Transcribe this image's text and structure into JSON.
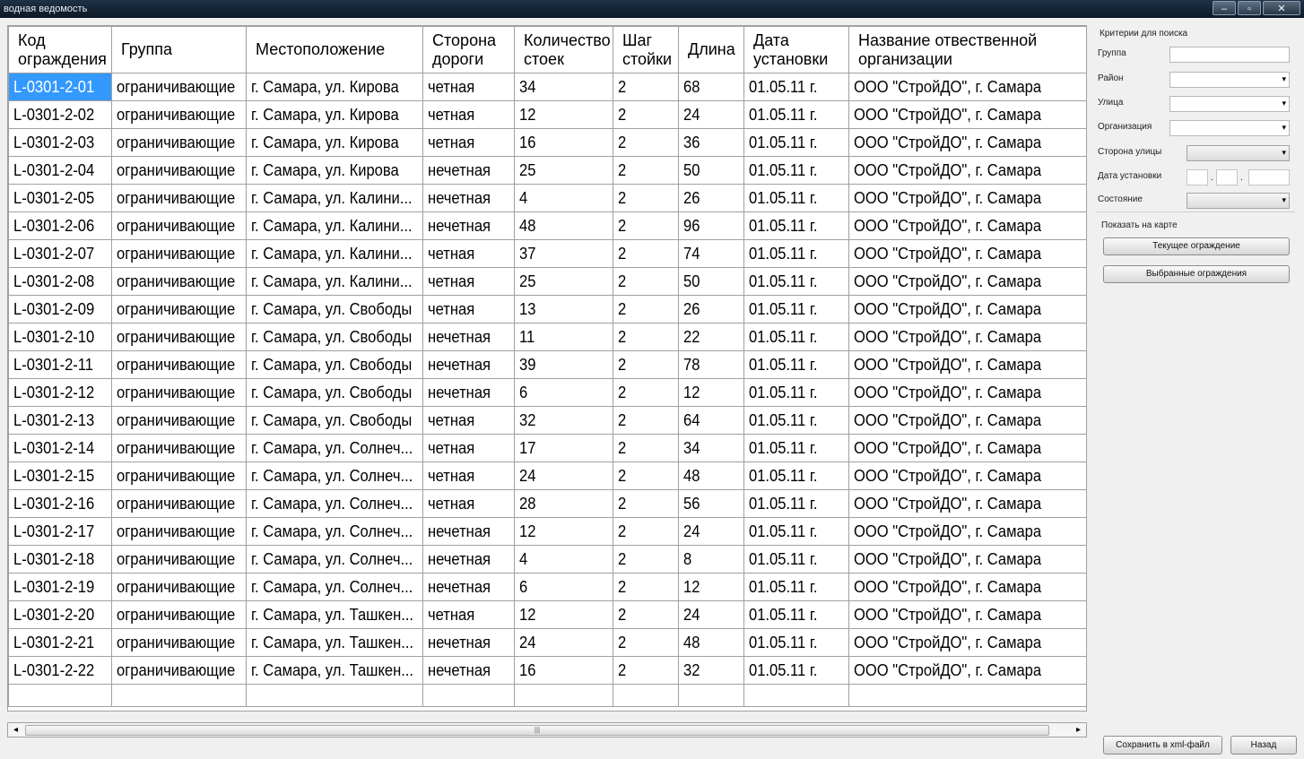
{
  "window": {
    "title": "водная ведомость",
    "minimize": "–",
    "maximize": "▫",
    "close": "✕"
  },
  "table": {
    "columns": [
      "Код ограждения",
      "Группа",
      "Местоположение",
      "Сторона дороги",
      "Количество стоек",
      "Шаг стойки",
      "Длина",
      "Дата установки",
      "Название отвественной организации"
    ],
    "rows": [
      [
        "L-0301-2-01",
        "ограничивающие",
        "г. Самара, ул. Кирова",
        "четная",
        "34",
        "2",
        "68",
        "01.05.11 г.",
        "ООО \"СтройДО\", г. Самара"
      ],
      [
        "L-0301-2-02",
        "ограничивающие",
        "г. Самара, ул. Кирова",
        "четная",
        "12",
        "2",
        "24",
        "01.05.11 г.",
        "ООО \"СтройДО\", г. Самара"
      ],
      [
        "L-0301-2-03",
        "ограничивающие",
        "г. Самара, ул. Кирова",
        "четная",
        "16",
        "2",
        "36",
        "01.05.11 г.",
        "ООО \"СтройДО\", г. Самара"
      ],
      [
        "L-0301-2-04",
        "ограничивающие",
        "г. Самара, ул. Кирова",
        "нечетная",
        "25",
        "2",
        "50",
        "01.05.11 г.",
        "ООО \"СтройДО\", г. Самара"
      ],
      [
        "L-0301-2-05",
        "ограничивающие",
        "г. Самара, ул. Калини...",
        "нечетная",
        "4",
        "2",
        "26",
        "01.05.11 г.",
        "ООО \"СтройДО\", г. Самара"
      ],
      [
        "L-0301-2-06",
        "ограничивающие",
        "г. Самара, ул. Калини...",
        "нечетная",
        "48",
        "2",
        "96",
        "01.05.11 г.",
        "ООО \"СтройДО\", г. Самара"
      ],
      [
        "L-0301-2-07",
        "ограничивающие",
        "г. Самара, ул. Калини...",
        "четная",
        "37",
        "2",
        "74",
        "01.05.11 г.",
        "ООО \"СтройДО\", г. Самара"
      ],
      [
        "L-0301-2-08",
        "ограничивающие",
        "г. Самара, ул. Калини...",
        "четная",
        "25",
        "2",
        "50",
        "01.05.11 г.",
        "ООО \"СтройДО\", г. Самара"
      ],
      [
        "L-0301-2-09",
        "ограничивающие",
        "г. Самара, ул. Свободы",
        "четная",
        "13",
        "2",
        "26",
        "01.05.11 г.",
        "ООО \"СтройДО\", г. Самара"
      ],
      [
        "L-0301-2-10",
        "ограничивающие",
        "г. Самара, ул. Свободы",
        "нечетная",
        "11",
        "2",
        "22",
        "01.05.11 г.",
        "ООО \"СтройДО\", г. Самара"
      ],
      [
        "L-0301-2-11",
        "ограничивающие",
        "г. Самара, ул. Свободы",
        "нечетная",
        "39",
        "2",
        "78",
        "01.05.11 г.",
        "ООО \"СтройДО\", г. Самара"
      ],
      [
        "L-0301-2-12",
        "ограничивающие",
        "г. Самара, ул. Свободы",
        "нечетная",
        "6",
        "2",
        "12",
        "01.05.11 г.",
        "ООО \"СтройДО\", г. Самара"
      ],
      [
        "L-0301-2-13",
        "ограничивающие",
        "г. Самара, ул. Свободы",
        "четная",
        "32",
        "2",
        "64",
        "01.05.11 г.",
        "ООО \"СтройДО\", г. Самара"
      ],
      [
        "L-0301-2-14",
        "ограничивающие",
        "г. Самара, ул. Солнеч...",
        "четная",
        "17",
        "2",
        "34",
        "01.05.11 г.",
        "ООО \"СтройДО\", г. Самара"
      ],
      [
        "L-0301-2-15",
        "ограничивающие",
        "г. Самара, ул. Солнеч...",
        "четная",
        "24",
        "2",
        "48",
        "01.05.11 г.",
        "ООО \"СтройДО\", г. Самара"
      ],
      [
        "L-0301-2-16",
        "ограничивающие",
        "г. Самара, ул. Солнеч...",
        "четная",
        "28",
        "2",
        "56",
        "01.05.11 г.",
        "ООО \"СтройДО\", г. Самара"
      ],
      [
        "L-0301-2-17",
        "ограничивающие",
        "г. Самара, ул. Солнеч...",
        "нечетная",
        "12",
        "2",
        "24",
        "01.05.11 г.",
        "ООО \"СтройДО\", г. Самара"
      ],
      [
        "L-0301-2-18",
        "ограничивающие",
        "г. Самара, ул. Солнеч...",
        "нечетная",
        "4",
        "2",
        "8",
        "01.05.11 г.",
        "ООО \"СтройДО\", г. Самара"
      ],
      [
        "L-0301-2-19",
        "ограничивающие",
        "г. Самара, ул. Солнеч...",
        "нечетная",
        "6",
        "2",
        "12",
        "01.05.11 г.",
        "ООО \"СтройДО\", г. Самара"
      ],
      [
        "L-0301-2-20",
        "ограничивающие",
        "г. Самара, ул. Ташкен...",
        "четная",
        "12",
        "2",
        "24",
        "01.05.11 г.",
        "ООО \"СтройДО\", г. Самара"
      ],
      [
        "L-0301-2-21",
        "ограничивающие",
        "г. Самара, ул. Ташкен...",
        "нечетная",
        "24",
        "2",
        "48",
        "01.05.11 г.",
        "ООО \"СтройДО\", г. Самара"
      ],
      [
        "L-0301-2-22",
        "ограничивающие",
        "г. Самара, ул. Ташкен...",
        "нечетная",
        "16",
        "2",
        "32",
        "01.05.11 г.",
        "ООО \"СтройДО\", г. Самара"
      ]
    ],
    "selected_row": 0
  },
  "scrollbar": {
    "left_arrow": "◂",
    "right_arrow": "▸",
    "grip": "|||"
  },
  "search": {
    "caption": "Критерии для поиска",
    "group_label": "Группа",
    "district_label": "Район",
    "street_label": "Улица",
    "organization_label": "Организация",
    "side_label": "Сторона улицы",
    "date_label": "Дата установки",
    "date_separator": ".",
    "state_label": "Состояние",
    "dropdown_glyph": "▾"
  },
  "map": {
    "caption": "Показать на карте",
    "current_button": "Текущее ограждение",
    "selected_button": "Выбранные ограждения"
  },
  "footer": {
    "save_button": "Сохранить в xml-файл",
    "back_button": "Назад"
  }
}
